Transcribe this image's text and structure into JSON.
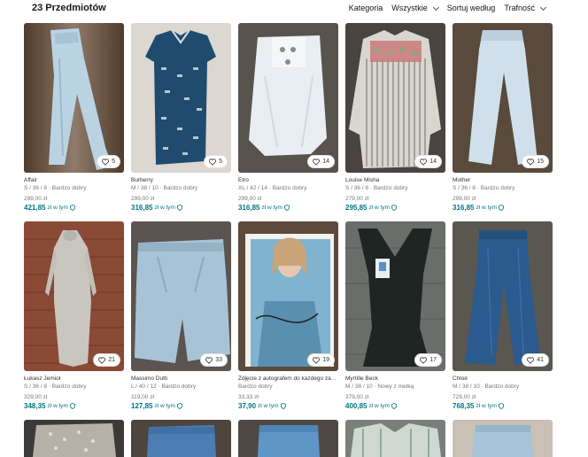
{
  "header": {
    "count": "23 Przedmiotów",
    "filters": [
      "Kategoria",
      "Wszystkie",
      "Sortuj według",
      "Trafność"
    ]
  },
  "price_suffix": "zł w tym",
  "items": [
    {
      "brand": "Affair",
      "size": "S / 36 / 8 · Bardzo dobry",
      "price": "299,00 zł",
      "price_incl": "421,85",
      "favs": "5",
      "bg": "#6b4f3a"
    },
    {
      "brand": "Burberry",
      "size": "M / 38 / 10 · Bardzo dobry",
      "price": "299,00 zł",
      "price_incl": "316,85",
      "favs": "5",
      "bg": "#dcd7d0"
    },
    {
      "brand": "Etro",
      "size": "XL / 42 / 14 · Bardzo dobry",
      "price": "299,00 zł",
      "price_incl": "316,85",
      "favs": "14",
      "bg": "#58534d"
    },
    {
      "brand": "Louise Misha",
      "size": "S / 36 / 8 · Bardzo dobry",
      "price": "279,00 zł",
      "price_incl": "295,85",
      "favs": "14",
      "bg": "#4a4440"
    },
    {
      "brand": "Mother",
      "size": "S / 36 / 8 · Bardzo dobry",
      "price": "299,00 zł",
      "price_incl": "316,85",
      "favs": "15",
      "bg": "#5a4a3c"
    },
    {
      "brand": "Łukasz Jemioł",
      "size": "S / 36 / 8 · Bardzo dobry",
      "price": "329,00 zł",
      "price_incl": "348,35",
      "favs": "21",
      "bg": "#8a4a35"
    },
    {
      "brand": "Massimo Dutti",
      "size": "L / 40 / 12 · Bardzo dobry",
      "price": "119,00 zł",
      "price_incl": "127,85",
      "favs": "33",
      "bg": "#5b5450"
    },
    {
      "brand": "Zdjęcie z autografem do każdego za...",
      "size": "Bardzo dobry",
      "price": "33,33 zł",
      "price_incl": "37,90",
      "favs": "19",
      "bg": "#5c4a3a"
    },
    {
      "brand": "Myrtille Beck",
      "size": "M / 38 / 10 · Nowy z metką",
      "price": "379,00 zł",
      "price_incl": "400,85",
      "favs": "17",
      "bg": "#6a6e6a"
    },
    {
      "brand": "Chloé",
      "size": "M / 38 / 10 · Bardzo dobry",
      "price": "729,00 zł",
      "price_incl": "768,35",
      "favs": "41",
      "bg": "#5a5650"
    }
  ],
  "bottom_row": [
    {
      "bg": "#3b3a38"
    },
    {
      "bg": "#4d453e"
    },
    {
      "bg": "#4f4944"
    },
    {
      "bg": "#7a7f7c"
    },
    {
      "bg": "#c9c1b6"
    }
  ],
  "colors": {
    "accent": "#007782"
  }
}
